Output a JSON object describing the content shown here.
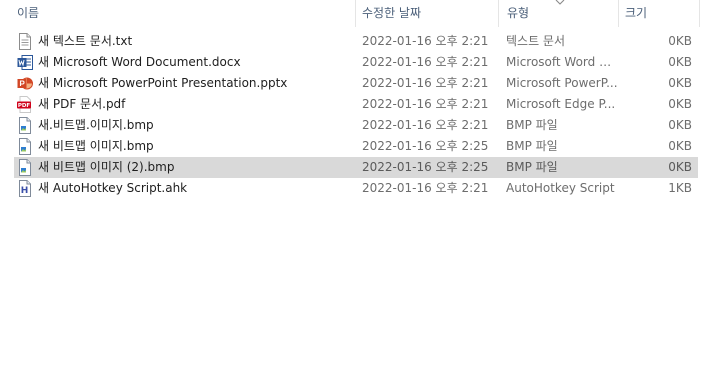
{
  "columns": {
    "name": "이름",
    "date": "수정한 날짜",
    "type": "유형",
    "size": "크기"
  },
  "files": [
    {
      "name": "새 텍스트 문서.txt",
      "date": "2022-01-16 오후 2:21",
      "type": "텍스트 문서",
      "size": "0KB",
      "icon": "text-document-icon",
      "selected": false
    },
    {
      "name": "새 Microsoft Word Document.docx",
      "date": "2022-01-16 오후 2:21",
      "type": "Microsoft Word D...",
      "size": "0KB",
      "icon": "word-document-icon",
      "selected": false
    },
    {
      "name": "새 Microsoft PowerPoint Presentation.pptx",
      "date": "2022-01-16 오후 2:21",
      "type": "Microsoft PowerP...",
      "size": "0KB",
      "icon": "powerpoint-icon",
      "selected": false
    },
    {
      "name": "새 PDF 문서.pdf",
      "date": "2022-01-16 오후 2:21",
      "type": "Microsoft Edge P...",
      "size": "0KB",
      "icon": "pdf-icon",
      "selected": false
    },
    {
      "name": "새.비트맵.이미지.bmp",
      "date": "2022-01-16 오후 2:21",
      "type": "BMP 파일",
      "size": "0KB",
      "icon": "bitmap-image-icon",
      "selected": false
    },
    {
      "name": "새 비트맵 이미지.bmp",
      "date": "2022-01-16 오후 2:25",
      "type": "BMP 파일",
      "size": "0KB",
      "icon": "bitmap-image-icon",
      "selected": false
    },
    {
      "name": "새 비트맵 이미지 (2).bmp",
      "date": "2022-01-16 오후 2:25",
      "type": "BMP 파일",
      "size": "0KB",
      "icon": "bitmap-image-icon",
      "selected": true
    },
    {
      "name": "새 AutoHotkey Script.ahk",
      "date": "2022-01-16 오후 2:21",
      "type": "AutoHotkey Script",
      "size": "1KB",
      "icon": "autohotkey-script-icon",
      "selected": false
    }
  ],
  "colors": {
    "header_text": "#4c607a",
    "selected_row": "#d9d9d9",
    "word": "#2b579a",
    "powerpoint": "#d24726",
    "pdf": "#d0021b",
    "autohotkey": "#3a4fa8"
  }
}
